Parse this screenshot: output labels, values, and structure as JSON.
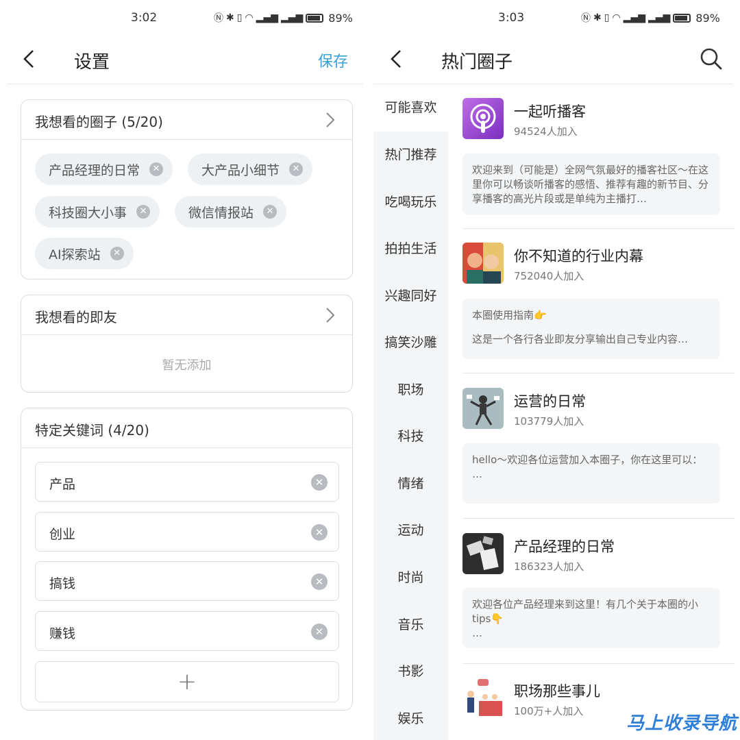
{
  "left": {
    "status": {
      "time": "3:02",
      "battery": "89%"
    },
    "title": "设置",
    "save_label": "保存",
    "circles_section": {
      "label": "我想看的圈子 (5/20)",
      "chips": [
        "产品经理的日常",
        "大产品小细节",
        "科技圈大小事",
        "微信情报站",
        "AI探索站"
      ]
    },
    "friends_section": {
      "label": "我想看的即友",
      "empty_text": "暂无添加"
    },
    "keywords_section": {
      "label": "特定关键词 (4/20)",
      "keywords": [
        "产品",
        "创业",
        "搞钱",
        "赚钱"
      ],
      "add_symbol": "+"
    }
  },
  "right": {
    "status": {
      "time": "3:03",
      "battery": "89%"
    },
    "title": "热门圈子",
    "categories": [
      "可能喜欢",
      "热门推荐",
      "吃喝玩乐",
      "拍拍生活",
      "兴趣同好",
      "搞笑沙雕",
      "职场",
      "科技",
      "情绪",
      "运动",
      "时尚",
      "音乐",
      "书影",
      "娱乐"
    ],
    "active_category": "可能喜欢",
    "circles": [
      {
        "name": "一起听播客",
        "count": "94524人加入",
        "desc": "欢迎来到（可能是）全网气氛最好的播客社区～在这里你可以畅谈听播客的感悟、推荐有趣的新节目、分享播客的高光片段或是单纯为主播打…"
      },
      {
        "name": "你不知道的行业内幕",
        "count": "752040人加入",
        "desc_title": "本圈使用指南👉",
        "desc": "这是一个各行各业即友分享输出自己专业内容…"
      },
      {
        "name": "运营的日常",
        "count": "103779人加入",
        "desc": "hello～欢迎各位运营加入本圈子，你在这里可以：",
        "desc_more": "…"
      },
      {
        "name": "产品经理的日常",
        "count": "186323人加入",
        "desc": "欢迎各位产品经理来到这里！有几个关于本圈的小tips👇",
        "desc_more": "…"
      },
      {
        "name": "职场那些事儿",
        "count": "100万+人加入"
      }
    ]
  },
  "watermark": "马上收录导航",
  "colors": {
    "accent": "#3aa0d8",
    "chip_bg": "#eef1f3",
    "sidebar_bg": "#f3f5f7",
    "watermark": "#2f7fd8"
  }
}
